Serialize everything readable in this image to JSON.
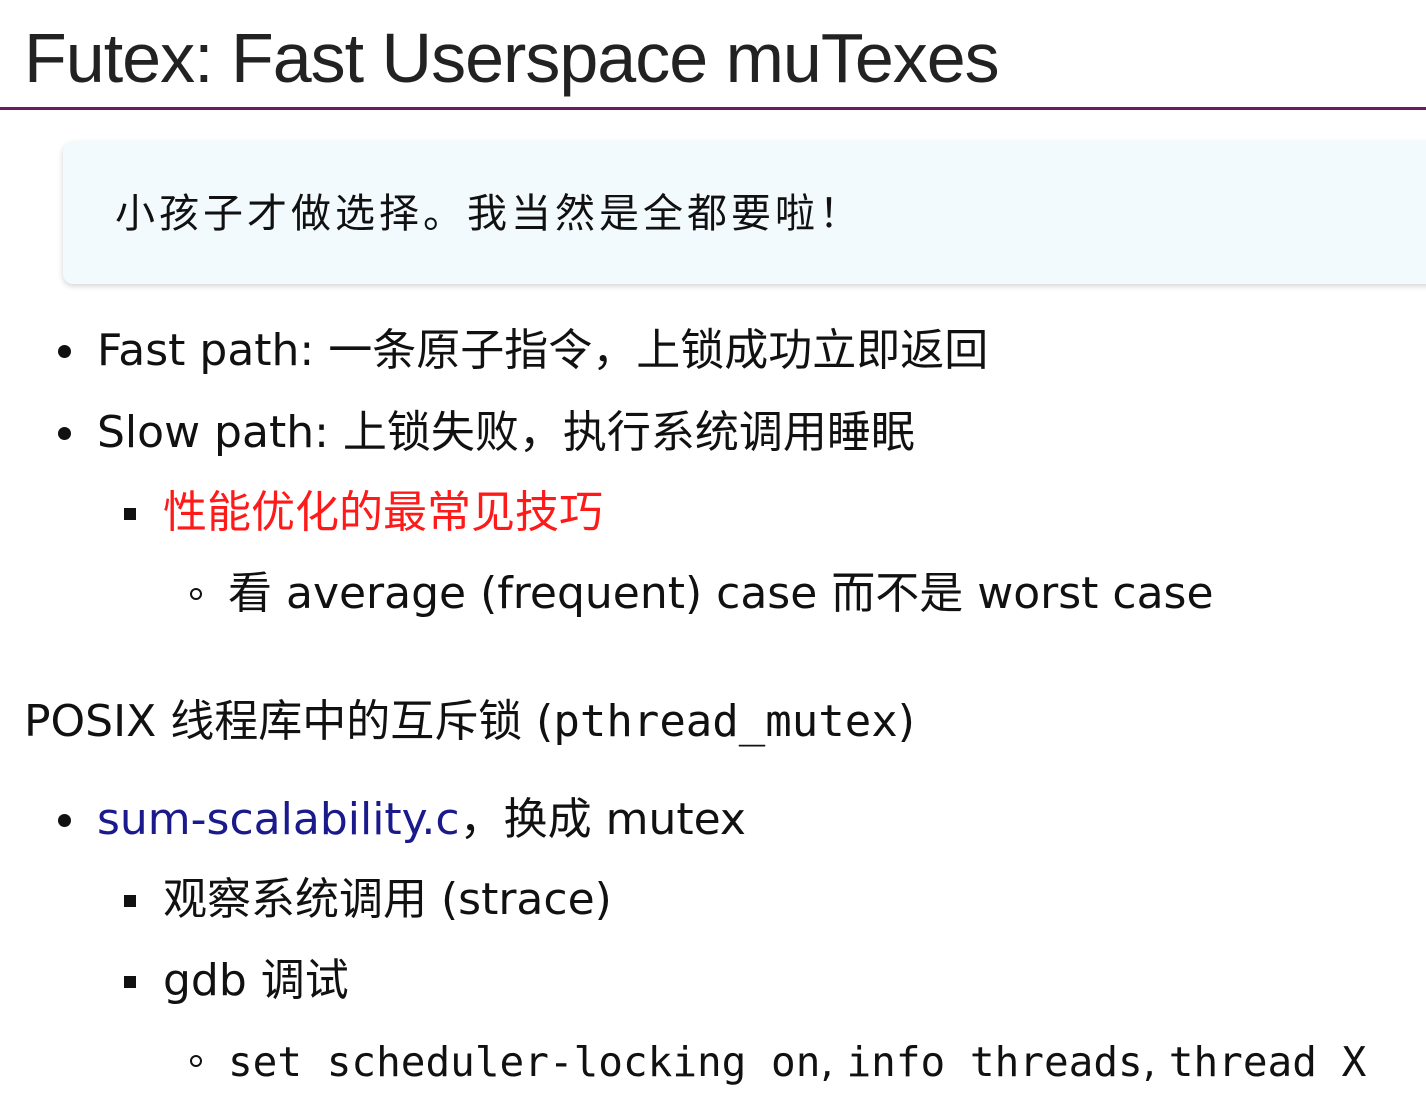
{
  "title": "Futex: Fast Userspace muTexes",
  "quote": "小孩子才做选择。我当然是全都要啦！",
  "bullets": {
    "fast_path": "Fast path: 一条原子指令，上锁成功立即返回",
    "slow_path": "Slow path: 上锁失败，执行系统调用睡眠",
    "slow_sub": "性能优化的最常见技巧",
    "slow_sub_sub": "看 average (frequent) case 而不是 worst case"
  },
  "section": {
    "label": "POSIX 线程库中的互斥锁 (",
    "code": "pthread_mutex",
    "close": ")"
  },
  "posix_bullets": {
    "link": "sum-scalability.c",
    "after_link": "，换成 mutex",
    "observe": "观察系统调用 (strace)",
    "gdb": "gdb 调试",
    "gdb_cmd_1": "set scheduler-locking on",
    "sep_1": ", ",
    "gdb_cmd_2": "info threads",
    "sep_2": ", ",
    "gdb_cmd_3": "thread X"
  }
}
